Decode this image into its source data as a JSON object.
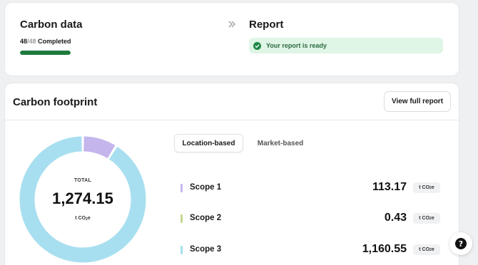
{
  "carbon_data": {
    "title": "Carbon data",
    "progress_done": "48",
    "progress_total": "/48",
    "progress_label": " Completed",
    "progress_fraction": 1.0
  },
  "report": {
    "title": "Report",
    "status": "Your report is ready"
  },
  "footprint": {
    "title": "Carbon footprint",
    "view_button": "View full report",
    "tabs": [
      {
        "label": "Location-based",
        "active": true
      },
      {
        "label": "Market-based",
        "active": false
      }
    ],
    "total": {
      "label": "TOTAL",
      "value": "1,274.15",
      "unit": "t CO",
      "unit_sub": "2",
      "unit_suffix": "e"
    },
    "scopes": [
      {
        "label": "Scope 1",
        "value": "113.17",
        "amount": 113.17,
        "color": "#c4b6ec"
      },
      {
        "label": "Scope 2",
        "value": "0.43",
        "amount": 0.43,
        "color": "#c5d88f"
      },
      {
        "label": "Scope 3",
        "value": "1,160.55",
        "amount": 1160.55,
        "color": "#a8dff0"
      }
    ],
    "unit_badge": {
      "unit": "t CO",
      "sub": "2",
      "suffix": "e"
    }
  },
  "icons": {
    "chevrons": "double-chevron-right-icon",
    "check": "check-circle-icon",
    "help": "question-mark-icon"
  },
  "colors": {
    "progress": "#1e7a3c",
    "success_bg": "#dff5e6",
    "success_text": "#2b6b3f"
  }
}
